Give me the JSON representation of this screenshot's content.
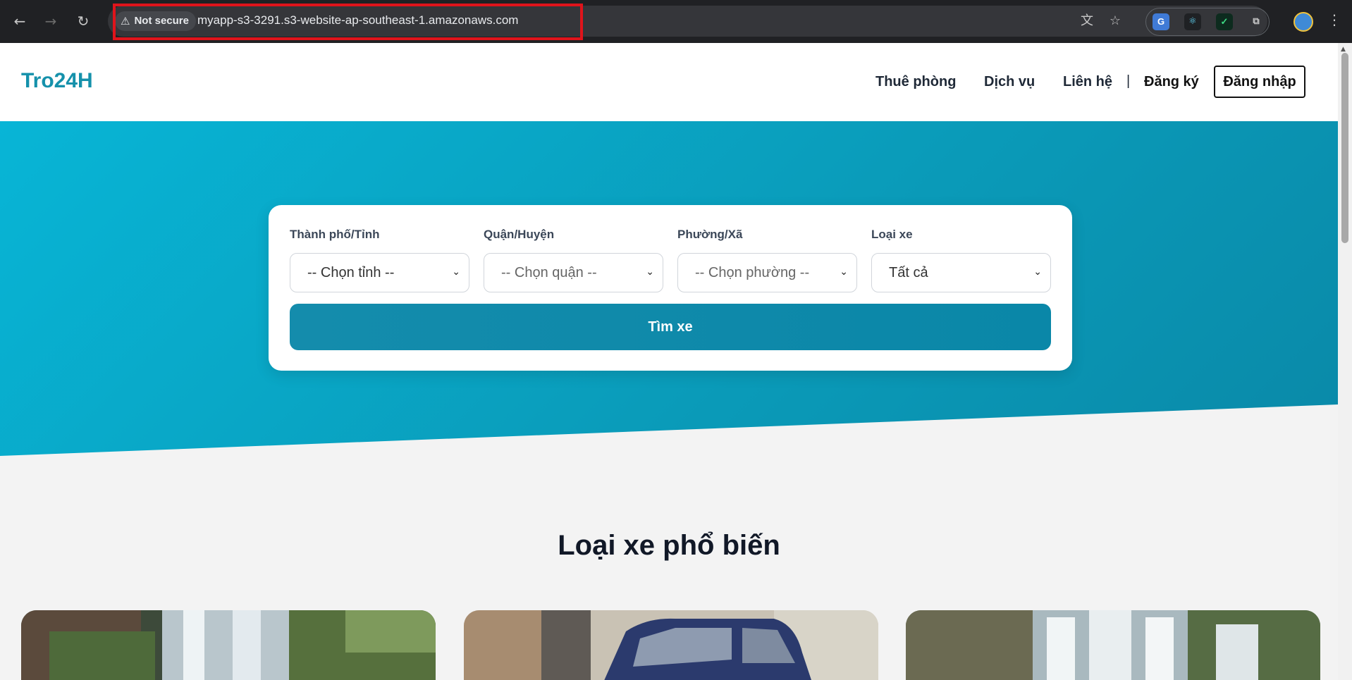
{
  "browser": {
    "security_label": "Not secure",
    "url": "myapp-s3-3291.s3-website-ap-southeast-1.amazonaws.com",
    "icons": [
      "back-icon",
      "forward-icon",
      "reload-icon",
      "translate-icon",
      "star-icon",
      "extensions-icon",
      "menu-icon"
    ]
  },
  "header": {
    "logo": "Tro24H",
    "nav": [
      "Thuê phòng",
      "Dịch vụ",
      "Liên hệ"
    ],
    "divider": "|",
    "register": "Đăng ký",
    "login": "Đăng nhập"
  },
  "search": {
    "fields": [
      {
        "label": "Thành phố/Tỉnh",
        "value": "-- Chọn tỉnh --"
      },
      {
        "label": "Quận/Huyện",
        "value": "-- Chọn quận --"
      },
      {
        "label": "Phường/Xã",
        "value": "-- Chọn phường --"
      },
      {
        "label": "Loại xe",
        "value": "Tất cả"
      }
    ],
    "button": "Tìm xe"
  },
  "section": {
    "title": "Loại xe phổ biến",
    "cards": [
      "waterfall-image",
      "car-image",
      "waterfall-image"
    ]
  },
  "colors": {
    "brand": "#1591ab",
    "hero_start": "#08b5d6",
    "hero_end": "#0a89a8",
    "highlight": "#e0141b"
  }
}
